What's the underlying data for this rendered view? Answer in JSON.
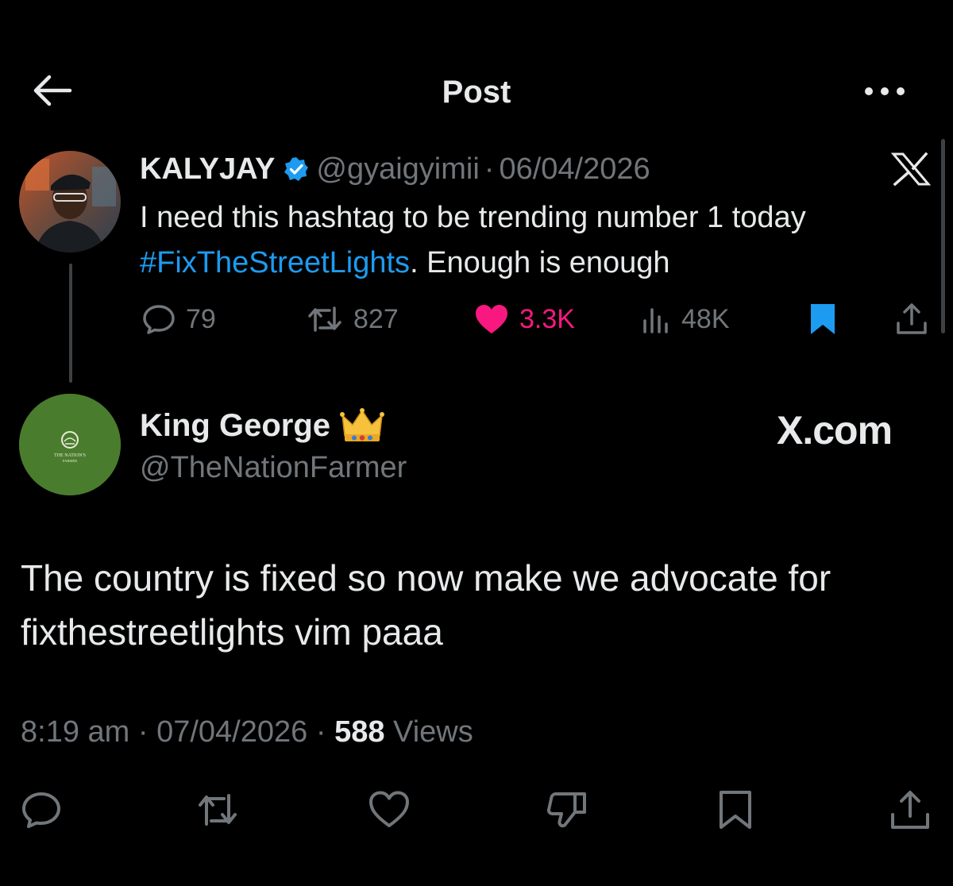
{
  "header": {
    "title": "Post"
  },
  "quoted_tweet": {
    "author_name": "KALYJAY",
    "handle": "@gyaigyimii",
    "separator": "·",
    "date": "06/04/2026",
    "text_before": "I need this hashtag to be trending number 1 today ",
    "hashtag": "#FixTheStreetLights",
    "text_after": ". Enough is enough",
    "stats": {
      "replies": "79",
      "reposts": "827",
      "likes": "3.3K",
      "views": "48K"
    },
    "liked": true,
    "bookmarked": true
  },
  "reply": {
    "author_name": "King George",
    "handle": "@TheNationFarmer",
    "watermark": "X.com",
    "text": "The country is fixed so now make we advocate for fixthestreetlights vim paaa",
    "time": "8:19 am",
    "separator": "·",
    "date": "07/04/2026",
    "views_count": "588",
    "views_label": "Views"
  },
  "avatar2_text": {
    "line1": "THE NATION'S",
    "line2": "FARMER"
  },
  "colors": {
    "accent": "#1d9bf0",
    "like": "#f91880",
    "muted": "#71767b",
    "text": "#e7e9ea",
    "background": "#000000"
  }
}
